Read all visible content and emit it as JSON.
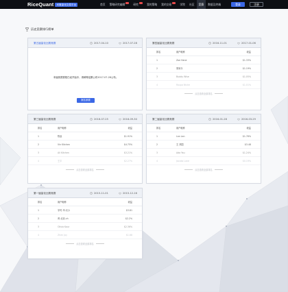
{
  "nav": {
    "logo": "RiceQuant",
    "logo_tag": "米筐量化交易平台",
    "items": [
      {
        "label": "首页",
        "active": false,
        "hot": false
      },
      {
        "label": "策略研究编辑",
        "active": false,
        "hot": true
      },
      {
        "label": "研究",
        "active": false,
        "hot": true
      },
      {
        "label": "我的策略",
        "active": false,
        "hot": false
      },
      {
        "label": "我的交易",
        "active": false,
        "hot": true
      },
      {
        "label": "学院",
        "active": false,
        "hot": false
      },
      {
        "label": "社区",
        "active": false,
        "hot": false
      },
      {
        "label": "竞赛",
        "active": true,
        "hot": false
      },
      {
        "label": "数据及终端",
        "active": false,
        "hot": false
      }
    ],
    "login": "登录",
    "register": "注册"
  },
  "page": {
    "title": "历史竞赛排行榜单"
  },
  "cards": {
    "c1": {
      "name": "第五届量化比赛竞赛",
      "start": "2017-04-10",
      "end": "2017-07-28",
      "message": "本届竞赛赛程已经开始中，请稍等结果公布2017-07-28公布。",
      "button": "报名参赛"
    },
    "c2": {
      "name": "第四届量化比赛竞赛",
      "start": "2016-11-01",
      "end": "2017-01-06",
      "col_rank": "排名",
      "col_user": "用户昵称",
      "col_return": "收益",
      "rows": [
        {
          "rank": "1",
          "user": "Zoe Hane",
          "ret": "$1.33%"
        },
        {
          "rank": "2",
          "user": "周军乐",
          "ret": "$1.19%"
        },
        {
          "rank": "3",
          "user": "Buddy Wise",
          "ret": "$1.05%"
        },
        {
          "rank": "4",
          "user": "Roupa Nishe",
          "ret": "$1.01%"
        }
      ],
      "footer": "点击查看全部排名"
    },
    "c3": {
      "name": "第三届量化比赛竞赛",
      "start": "2016-07-25",
      "end": "2016-09-30",
      "col_rank": "排名",
      "col_user": "用户昵称",
      "col_return": "收益",
      "rows": [
        {
          "rank": "1",
          "user": "陈晨",
          "ret": "$1.91%"
        },
        {
          "rank": "2",
          "user": "Vin Kitchen",
          "ret": "$4.75%"
        },
        {
          "rank": "3",
          "user": "Ali Kitchen",
          "ret": "$3.21%"
        },
        {
          "rank": "4",
          "user": "王平",
          "ret": "$2.27%"
        }
      ],
      "footer": "点击查看全部排名"
    },
    "c4": {
      "name": "第二届量化比赛竞赛",
      "start": "2016-01-28",
      "end": "2016-03-29",
      "col_rank": "排名",
      "col_user": "用户昵称",
      "col_return": "收益",
      "rows": [
        {
          "rank": "1",
          "user": "Lan Lan",
          "ret": "$1.76%"
        },
        {
          "rank": "2",
          "user": "王 邦国",
          "ret": "$3.48"
        },
        {
          "rank": "3",
          "user": "Ada Yau",
          "ret": "$1.24%"
        },
        {
          "rank": "4",
          "user": "Jacobs Lane",
          "ret": "$0.19%"
        }
      ],
      "footer": "点击查看全部排名"
    },
    "c5": {
      "name": "第一届量化比赛竞赛",
      "start": "2015-11-01",
      "end": "2015-12-16",
      "col_rank": "排名",
      "col_user": "用户昵称",
      "col_return": "收益",
      "rows": [
        {
          "rank": "1",
          "user": "宇时-市-长沙",
          "ret": "$3.81"
        },
        {
          "rank": "2",
          "user": "黄-北京-ch",
          "ret": "$2.2%"
        },
        {
          "rank": "3",
          "user": "Olivia Kaur",
          "ret": "$2.36%"
        },
        {
          "rank": "4",
          "user": "Zhen Joy",
          "ret": "$1.88"
        }
      ],
      "footer": "点击查看全部排名"
    }
  }
}
